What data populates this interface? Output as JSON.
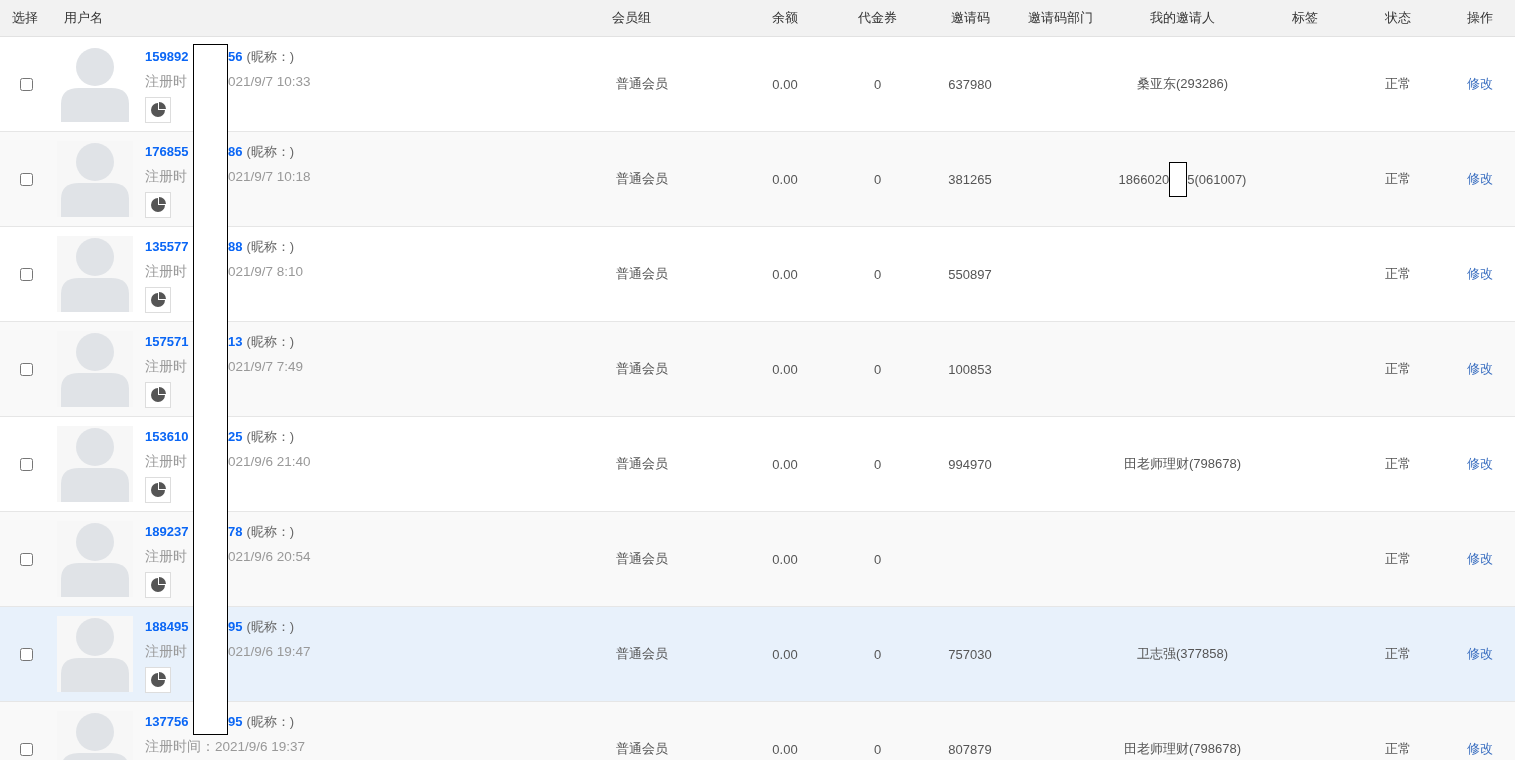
{
  "columns": [
    "选择",
    "用户名",
    "会员组",
    "余额",
    "代金券",
    "邀请码",
    "邀请码部门",
    "我的邀请人",
    "标签",
    "状态",
    "操作"
  ],
  "rows": [
    {
      "checked": false,
      "highlighted": false,
      "name_before": "159892",
      "name_after": "56",
      "nickname": "(昵称：)",
      "reg_before": "注册时",
      "reg_after": "021/9/7 10:33",
      "stats_button": true,
      "group": "普通会员",
      "balance": "0.00",
      "vouchers": "0",
      "invite_code": "637980",
      "inviter": "桑亚东(293286)",
      "status": "正常",
      "action": "修改"
    },
    {
      "checked": false,
      "highlighted": false,
      "name_before": "176855",
      "name_after": "86",
      "nickname": "(昵称：)",
      "reg_before": "注册时",
      "reg_after": "021/9/7 10:18",
      "stats_button": true,
      "group": "普通会员",
      "balance": "0.00",
      "vouchers": "0",
      "invite_code": "381265",
      "inviter_before": "1866020",
      "inviter_after": "5(061007)",
      "status": "正常",
      "action": "修改"
    },
    {
      "checked": false,
      "highlighted": false,
      "name_before": "135577",
      "name_after": "88",
      "nickname": "(昵称：)",
      "reg_before": "注册时",
      "reg_after": "021/9/7 8:10",
      "stats_button": true,
      "group": "普通会员",
      "balance": "0.00",
      "vouchers": "0",
      "invite_code": "550897",
      "status": "正常",
      "action": "修改"
    },
    {
      "checked": false,
      "highlighted": false,
      "name_before": "157571",
      "name_after": "13",
      "nickname": "(昵称：)",
      "reg_before": "注册时",
      "reg_after": "021/9/7 7:49",
      "stats_button": true,
      "group": "普通会员",
      "balance": "0.00",
      "vouchers": "0",
      "invite_code": "100853",
      "status": "正常",
      "action": "修改"
    },
    {
      "checked": false,
      "highlighted": false,
      "name_before": "153610",
      "name_after": "25",
      "nickname": "(昵称：)",
      "reg_before": "注册时",
      "reg_after": "021/9/6 21:40",
      "stats_button": true,
      "group": "普通会员",
      "balance": "0.00",
      "vouchers": "0",
      "invite_code": "994970",
      "inviter": "田老师理财(798678)",
      "status": "正常",
      "action": "修改"
    },
    {
      "checked": false,
      "highlighted": false,
      "name_before": "189237",
      "name_after": "78",
      "nickname": "(昵称：)",
      "reg_before": "注册时",
      "reg_after": "021/9/6 20:54",
      "stats_button": true,
      "group": "普通会员",
      "balance": "0.00",
      "vouchers": "0",
      "status": "正常",
      "action": "修改"
    },
    {
      "checked": false,
      "highlighted": true,
      "name_before": "188495",
      "name_after": "95",
      "nickname": "(昵称：)",
      "reg_before": "注册时",
      "reg_after": "021/9/6 19:47",
      "stats_button": true,
      "group": "普通会员",
      "balance": "0.00",
      "vouchers": "0",
      "invite_code": "757030",
      "inviter": "卫志强(377858)",
      "status": "正常",
      "action": "修改"
    },
    {
      "checked": false,
      "highlighted": false,
      "name_before": "137756",
      "name_after": "95",
      "nickname": "(昵称：)",
      "reg_time": "注册时间：2021/9/6 19:37",
      "group": "普通会员",
      "balance": "0.00",
      "vouchers": "0",
      "invite_code": "807879",
      "inviter": "田老师理财(798678)",
      "status": "正常",
      "action": "修改"
    }
  ]
}
